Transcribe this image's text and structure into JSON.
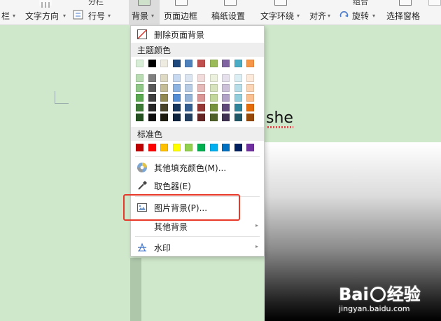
{
  "ribbon": {
    "cut_left_label": "栏",
    "text_direction_label": "文字方向",
    "top_partial_label": "分栏",
    "line_number_label": "行号",
    "background_label": "背景",
    "page_border_label": "页面边框",
    "paper_settings_label": "稿纸设置",
    "text_wrap_label": "文字环绕",
    "align_label": "对齐",
    "rotate_label": "旋转",
    "select_pane_label": "选择窗格",
    "top_partial_right": "组合"
  },
  "document": {
    "word": "she"
  },
  "background_menu": {
    "remove_bg_label": "删除页面背景",
    "theme_colors_header": "主题颜色",
    "standard_colors_header": "标准色",
    "more_fill_label": "其他填充颜色(M)...",
    "eyedropper_label": "取色器(E)",
    "picture_bg_label": "图片背景(P)...",
    "other_bg_label": "其他背景",
    "watermark_label": "水印",
    "theme_top_row": [
      "#d9eed6",
      "#000000",
      "#eeece1",
      "#1f497d",
      "#4f81bd",
      "#c0504d",
      "#9bbb59",
      "#8064a2",
      "#4bacc6",
      "#f79646"
    ],
    "theme_shades": [
      [
        "#b9dcb3",
        "#7f7f7f",
        "#ddd9c3",
        "#c6d9f0",
        "#dbe5f1",
        "#f2dcdb",
        "#ebf1dd",
        "#e5e0ec",
        "#dbeef3",
        "#fdeada"
      ],
      [
        "#8fc887",
        "#595959",
        "#c4bd97",
        "#8db3e2",
        "#b8cce4",
        "#e5b9b7",
        "#d7e3bc",
        "#ccc1d9",
        "#b7dde8",
        "#fbd5b5"
      ],
      [
        "#5aa950",
        "#3f3f3f",
        "#938953",
        "#548dd4",
        "#95b3d7",
        "#d99694",
        "#c3d69b",
        "#b2a2c7",
        "#92cddc",
        "#fac08f"
      ],
      [
        "#3d7a35",
        "#262626",
        "#494429",
        "#17365d",
        "#366092",
        "#953734",
        "#76923c",
        "#5f497a",
        "#31859b",
        "#e36c09"
      ],
      [
        "#25501f",
        "#0c0c0c",
        "#1d1b10",
        "#0f243e",
        "#244061",
        "#632423",
        "#4f6128",
        "#3f3151",
        "#205867",
        "#974806"
      ]
    ],
    "standard_colors": [
      "#c00000",
      "#ff0000",
      "#ffc000",
      "#ffff00",
      "#92d050",
      "#00b050",
      "#00b0f0",
      "#0070c0",
      "#002060",
      "#7030a0"
    ]
  },
  "highlight_color": "#e8382a",
  "watermark": {
    "logo_left": "Bai",
    "logo_right": "经验",
    "url": "jingyan.baidu.com"
  }
}
